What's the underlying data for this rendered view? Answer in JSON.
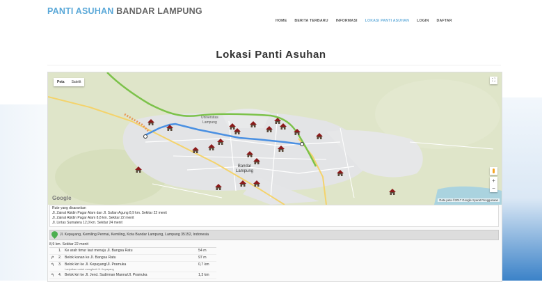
{
  "brand": {
    "part1": "PANTI ASUHAN",
    "part2": "BANDAR LAMPUNG",
    "color1": "#5aa8d8",
    "color2": "#666666"
  },
  "nav": [
    {
      "label": "HOME",
      "active": false
    },
    {
      "label": "BERITA TERBARU",
      "active": false
    },
    {
      "label": "INFORMASI",
      "active": false
    },
    {
      "label": "LOKASI PANTI ASUHAN",
      "active": true
    },
    {
      "label": "LOGIN",
      "active": false
    },
    {
      "label": "DAFTAR",
      "active": false
    }
  ],
  "page_title": "Lokasi Panti Asuhan",
  "map": {
    "map_type_buttons": [
      "Peta",
      "Satelit"
    ],
    "fullscreen_icon": "fullscreen-icon",
    "city_label_line1": "Bandar",
    "city_label_line2": "Lampung",
    "university_label_line1": "Universitas",
    "university_label_line2": "Lampung",
    "google_logo": "Google",
    "attribution": "Data peta ©2017 Google   Syarat Penggunaan",
    "zoom_in": "+",
    "zoom_out": "−",
    "marker_icon": "house-marker-icon",
    "route_color": "#4a90e2",
    "highway_color": "#7cc24a"
  },
  "routes": {
    "header": "Rute yang disarankan",
    "options": [
      "Jl. Zainal Abidin Pagar Alam dan Jl. Sultan Agung 8,9 km. Sekitar 22 menit",
      "Jl. Zainal Abidin Pagar Alam 8,8 km. Sekitar 22 menit",
      "Jl. Lintas Sumatera 12,0 km. Sekitar 24 menit"
    ]
  },
  "destination": "Jl. Kepayang, Kemiling Permai, Kemiling, Kota Bandar Lampung, Lampung 35152, Indonesia",
  "summary": "8,9 km. Sekitar 22 menit",
  "steps": [
    {
      "num": "1.",
      "icon": "",
      "text": "Ke arah timur laut menuju Jl. Bangsa Ratu",
      "sub": "",
      "dist": "54 m"
    },
    {
      "num": "2.",
      "icon": "↱",
      "text": "Belok kanan ke Jl. Bangsa Ratu",
      "sub": "",
      "dist": "97 m"
    },
    {
      "num": "3.",
      "icon": "↰",
      "text": "Belok kiri ke Jl. Kepayang/Jl. Pramuka",
      "sub": "Lanjutkan untuk mengikuti Jl. Kepayang",
      "dist": "0,7 km"
    },
    {
      "num": "4.",
      "icon": "↰",
      "text": "Belok kiri ke Jl. Jend. Sudirman Manna/Jl. Pramuka",
      "sub": "",
      "dist": "1,3 km"
    }
  ]
}
